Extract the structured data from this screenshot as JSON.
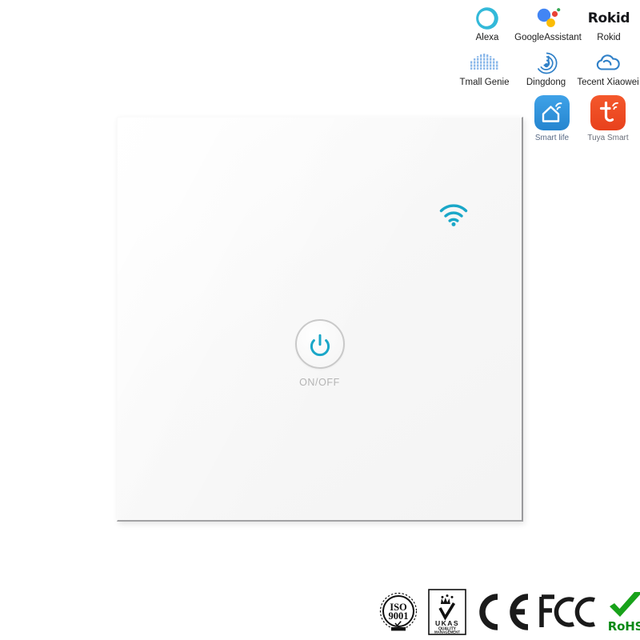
{
  "product": {
    "panel_label": "ON/OFF",
    "wifi_icon": "wifi-icon",
    "power_icon": "power-icon"
  },
  "voice_assistants": {
    "row1": [
      {
        "name": "Alexa",
        "icon": "alexa-ring-icon",
        "color": "#33b9d9"
      },
      {
        "name": "GoogleAssistant",
        "icon": "google-assistant-dots-icon",
        "color": "#4285f4"
      },
      {
        "name": "Rokid",
        "icon": "rokid-wordmark-icon",
        "color": "#15161a"
      }
    ],
    "row2": [
      {
        "name": "Tmall Genie",
        "icon": "tmall-genie-waveform-icon",
        "color": "#7fb0e8"
      },
      {
        "name": "Dingdong",
        "icon": "dingdong-rings-icon",
        "color": "#2f80c8"
      },
      {
        "name": "Tecent Xiaowei",
        "icon": "tencent-xiaowei-cloud-icon",
        "color": "#2f80c8"
      }
    ]
  },
  "apps": [
    {
      "name": "Smart life",
      "icon": "smart-life-house-icon",
      "color": "#3296e0"
    },
    {
      "name": "Tuya Smart",
      "icon": "tuya-smart-t-icon",
      "color": "#f04d23"
    }
  ],
  "certifications": [
    {
      "name": "ISO 9001",
      "icon": "iso-9001-seal-icon",
      "line1": "ISO",
      "line2": "9001",
      "color": "#111111"
    },
    {
      "name": "UKAS",
      "icon": "ukas-crown-icon",
      "line1": "UKAS",
      "line2": "QUALITY",
      "line3": "MANAGEMENT",
      "color": "#111111"
    },
    {
      "name": "CE",
      "icon": "ce-mark-icon",
      "color": "#1a1a1a"
    },
    {
      "name": "FCC",
      "icon": "fcc-mark-icon",
      "color": "#1a1a1a"
    },
    {
      "name": "RoHS",
      "icon": "rohs-check-icon",
      "label": "RoHS",
      "color": "#0a8a16"
    }
  ],
  "colors": {
    "accent_cyan": "#1aa7c8",
    "panel_white": "#f7f7f7",
    "label_gray": "#b4b4b4"
  }
}
